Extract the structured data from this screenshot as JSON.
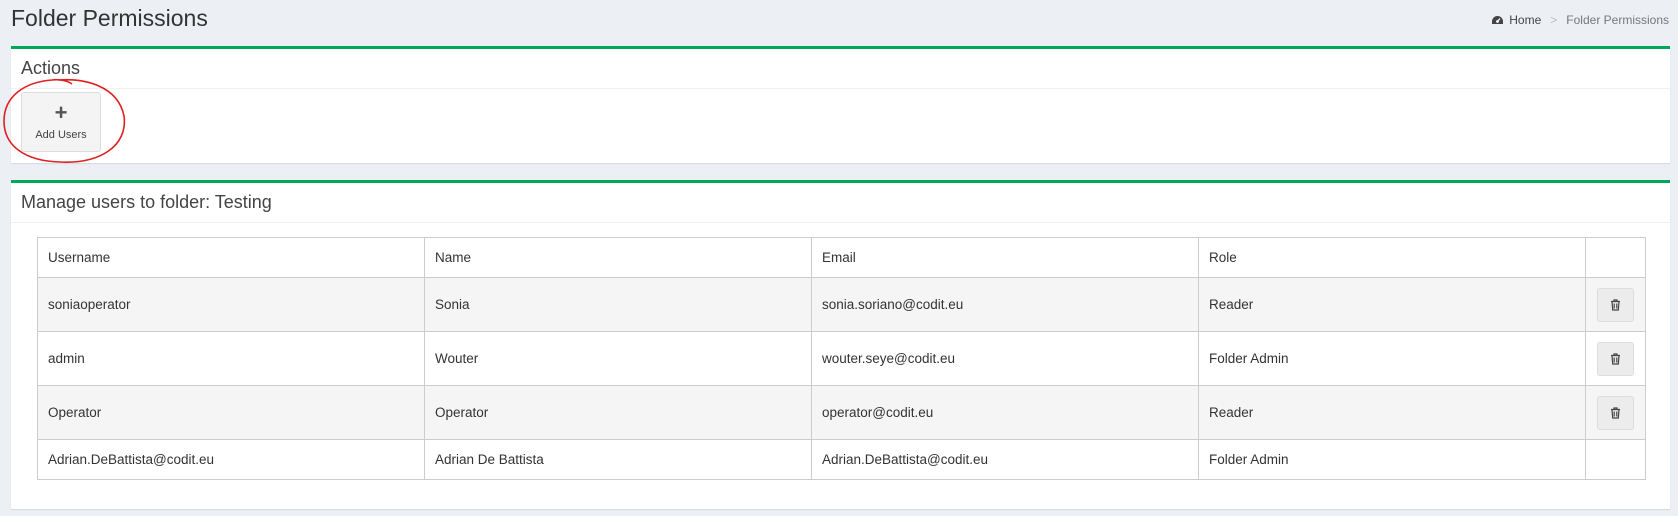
{
  "header": {
    "title": "Folder Permissions",
    "breadcrumb": {
      "home": "Home",
      "current": "Folder Permissions"
    }
  },
  "actions": {
    "title": "Actions",
    "add_users_label": "Add Users"
  },
  "users_panel": {
    "title": "Manage users to folder: Testing",
    "columns": [
      "Username",
      "Name",
      "Email",
      "Role"
    ],
    "rows": [
      {
        "username": "soniaoperator",
        "name": "Sonia",
        "email": "sonia.soriano@codit.eu",
        "role": "Reader",
        "deletable": true
      },
      {
        "username": "admin",
        "name": "Wouter",
        "email": "wouter.seye@codit.eu",
        "role": "Folder Admin",
        "deletable": true
      },
      {
        "username": "Operator",
        "name": "Operator",
        "email": "operator@codit.eu",
        "role": "Reader",
        "deletable": true
      },
      {
        "username": "Adrian.DeBattista@codit.eu",
        "name": "Adrian De Battista",
        "email": "Adrian.DeBattista@codit.eu",
        "role": "Folder Admin",
        "deletable": false
      }
    ]
  },
  "colors": {
    "accent": "#00a65a",
    "annotation": "#e02020"
  }
}
